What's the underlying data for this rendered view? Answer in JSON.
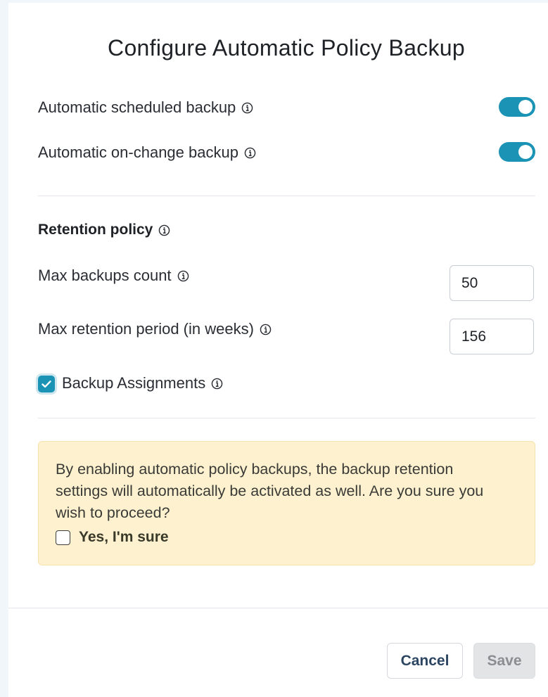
{
  "dialog": {
    "title": "Configure Automatic Policy Backup"
  },
  "toggles": {
    "scheduled": {
      "label": "Automatic scheduled backup",
      "on": true
    },
    "on_change": {
      "label": "Automatic on-change backup",
      "on": true
    }
  },
  "retention": {
    "title": "Retention policy",
    "max_count": {
      "label": "Max backups count",
      "value": "50"
    },
    "max_period": {
      "label": "Max retention period (in weeks)",
      "value": "156"
    },
    "backup_assignments": {
      "label": "Backup Assignments",
      "checked": true
    }
  },
  "warning": {
    "text": "By enabling automatic policy backups, the backup retention settings will automatically be activated as well. Are you sure you wish to proceed?",
    "confirm_label": "Yes, I'm sure",
    "confirm_checked": false
  },
  "buttons": {
    "cancel": "Cancel",
    "save": "Save"
  },
  "colors": {
    "accent": "#1a93b5",
    "warning_bg": "#fdf1cf"
  },
  "icons": {
    "info": "info-icon",
    "check": "check-icon"
  }
}
